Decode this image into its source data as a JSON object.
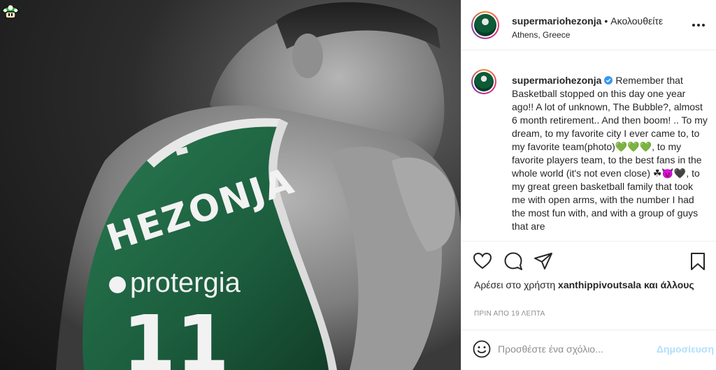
{
  "post": {
    "username": "supermariohezonja",
    "follow_status": "Ακολουθείτε",
    "separator": "•",
    "location": "Athens, Greece",
    "photo": {
      "jersey_name": "HEZONJA",
      "sponsor": "protergia",
      "number": "11"
    },
    "caption": "Remember that Basketball stopped on this day one year ago!! A lot of unknown, The Bubble?, almost 6 month retirement.. And then boom! .. To my dream, to my favorite city I ever came to, to my favorite team(photo)💚💚💚, to my favorite players team, to the best fans in the whole world (it's not even close) ☘😈🖤, to my great green basketball family that took me with open arms, with the number I had the most fun with, and with a group of guys that are",
    "likes_prefix": "Αρέσει στο χρήστη",
    "likes_user": "xanthippivoutsala",
    "likes_suffix": "και άλλους",
    "time_ago": "ΠΡΙΝ ΑΠΟ 19 ΛΕΠΤΑ",
    "comment_placeholder": "Προσθέστε ένα σχόλιο...",
    "post_button": "Δημοσίευση"
  },
  "icons": {
    "corner": "mushroom-icon",
    "more": "more-options-icon",
    "verified": "verified-badge-icon",
    "like": "heart-icon",
    "comment": "comment-icon",
    "share": "share-icon",
    "save": "bookmark-icon",
    "emoji": "emoji-icon"
  },
  "colors": {
    "jersey_green": "#1f6b46",
    "verified_blue": "#3897f0",
    "post_button_disabled": "#b2dffc",
    "muted_text": "#8e8e8e"
  }
}
